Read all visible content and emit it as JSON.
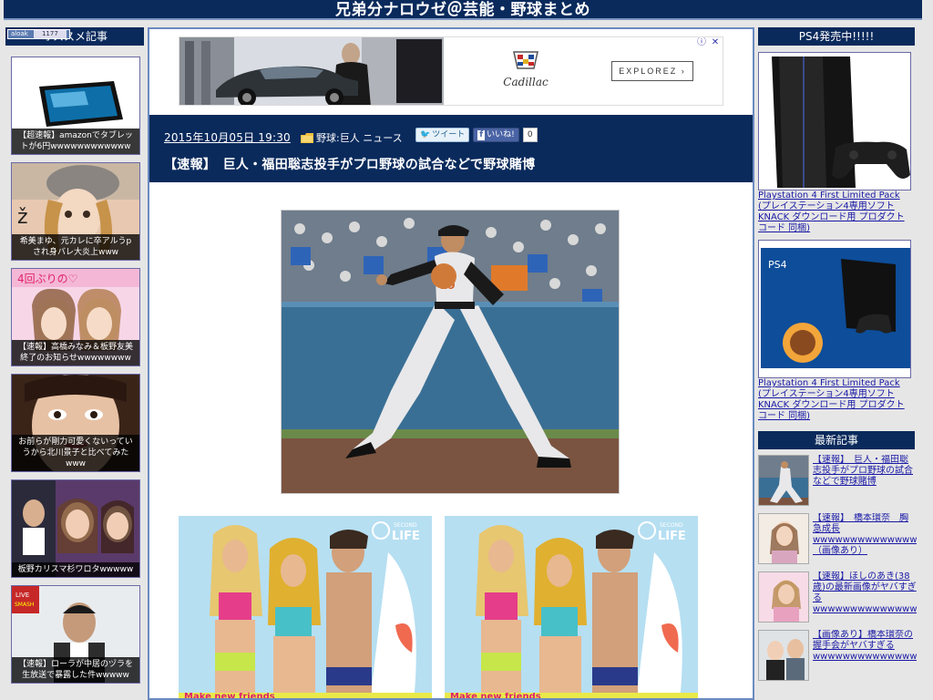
{
  "site": {
    "title": "兄弟分ナロウゼ＠芸能・野球まとめ"
  },
  "left_sidebar": {
    "heading": "オススメ記事",
    "badge_label": "aloak",
    "badge_value": "1177",
    "items": [
      {
        "caption": "【超速報】amazonでタブレットが6円wwwwwwwwwwww"
      },
      {
        "caption": "希美まゆ、元カレに卒アルうp され身バレ大炎上www"
      },
      {
        "caption": "【速報】高橋みなみ＆板野友美終了のお知らせwwwwwwww"
      },
      {
        "caption": "お前らが剛力可愛くないっていうから北川景子と比べてみたwww"
      },
      {
        "caption": "板野カリスマ杉ワロタwwwww"
      },
      {
        "caption": "【速報】ローラが中居のヅラを生放送で暴露した件wwwww"
      }
    ]
  },
  "top_ad": {
    "brand": "Cadillac",
    "cta": "EXPLOREZ",
    "info_icon": "ⓘ",
    "close_icon": "✕"
  },
  "post": {
    "date": "2015年10月05日 19:30",
    "category": "野球:巨人 ニュース",
    "tweet_label": "ツイート",
    "like_label": "いいね!",
    "like_count": "0",
    "title": "【速報】　巨人・福田聡志投手がプロ野球の試合などで野球賭博",
    "image_alt": "pitcher-photo"
  },
  "banners": [
    {
      "brand": "SECOND LIFE",
      "footer": "Make new friends"
    },
    {
      "brand": "SECOND LIFE",
      "footer": "Make new friends"
    }
  ],
  "right_sidebar": {
    "heading": "PS4発売中!!!!!",
    "products": [
      {
        "title": "Playstation 4 First Limited Pack (プレイステーション4専用ソフト KNACK ダウンロード用 プロダクトコード 同梱)"
      },
      {
        "title": "Playstation 4 First Limited Pack (プレイステーション4専用ソフト KNACK ダウンロード用 プロダクトコード 同梱)"
      }
    ],
    "latest_heading": "最新記事",
    "latest": [
      {
        "title": "【速報】　巨人・福田聡志投手がプロ野球の試合などで野球賭博"
      },
      {
        "title": "【速報】　橋本環奈　胸急成長wwwwwwwwwwwwwwwwwww（画像あり）"
      },
      {
        "title": "【速報】ほしのあき(38歳)の最新画像がヤバすぎるwwwwwwwwwwwwwwwww"
      },
      {
        "title": "【画像あり】橋本環奈の握手会がヤバすぎるwwwwwwwwwwwwwwwwwwwwwww"
      }
    ]
  },
  "colors": {
    "navy": "#0a2a5c",
    "link": "#1a1aa6",
    "page_bg": "#e6e6e6"
  }
}
